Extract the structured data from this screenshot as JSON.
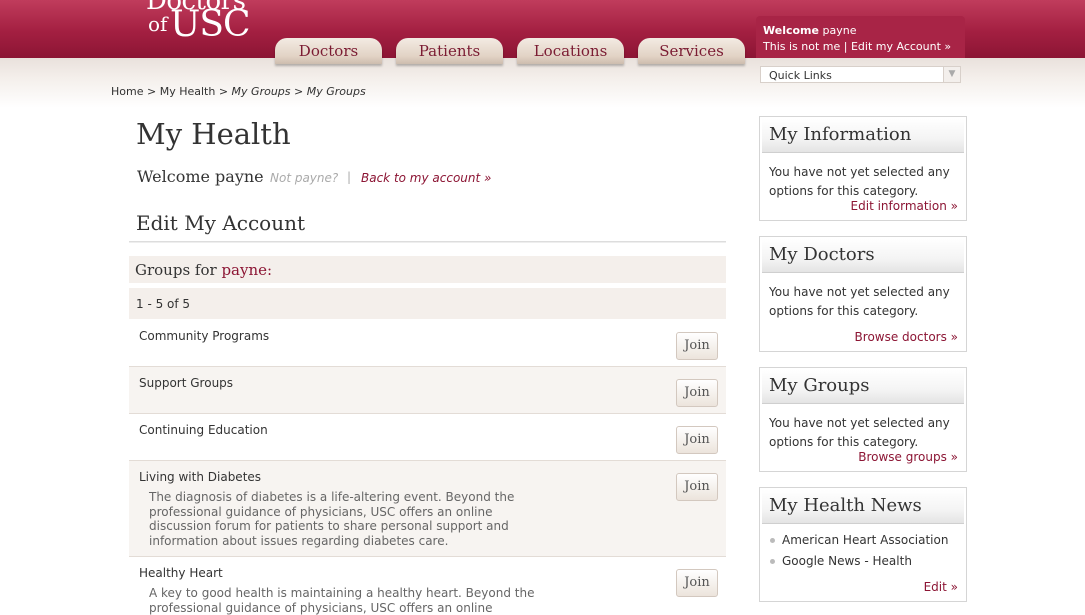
{
  "logo": {
    "line1": "Doctors",
    "line2": "of",
    "line3": "USC"
  },
  "nav": {
    "tabs": [
      "Doctors",
      "Patients",
      "Locations",
      "Services"
    ]
  },
  "user_box": {
    "welcome_label": "Welcome",
    "username": "payne",
    "not_me": "This is not me",
    "separator": "|",
    "edit_account": "Edit my Account »"
  },
  "quick_links": {
    "label": "Quick Links"
  },
  "breadcrumb": {
    "home": "Home",
    "sep": ">",
    "my_health": "My Health",
    "my_groups_1": "My Groups",
    "my_groups_2": "My Groups"
  },
  "main": {
    "title": "My Health",
    "welcome": "Welcome payne",
    "not_user": "Not payne?",
    "separator": "|",
    "back_link": "Back to my account »",
    "section_title": "Edit My Account",
    "groups_prefix": "Groups for",
    "groups_user": "payne:",
    "counter": "1 - 5 of 5",
    "join_label": "Join",
    "groups": [
      {
        "name": "Community Programs",
        "description": ""
      },
      {
        "name": "Support Groups",
        "description": ""
      },
      {
        "name": "Continuing Education",
        "description": ""
      },
      {
        "name": "Living with Diabetes",
        "description": "The diagnosis of diabetes is a life-altering event. Beyond the professional guidance of physicians, USC offers an online discussion forum for patients to share personal support and information about issues regarding diabetes care."
      },
      {
        "name": "Healthy Heart",
        "description": "A key to good health is maintaining a healthy heart. Beyond the professional guidance of physicians, USC offers an online"
      }
    ]
  },
  "sidebar": {
    "my_information": {
      "title": "My Information",
      "text": "You have not yet selected any options for this category.",
      "link": "Edit information »"
    },
    "my_doctors": {
      "title": "My Doctors",
      "text": "You have not yet selected any options for this category.",
      "link": "Browse doctors »"
    },
    "my_groups": {
      "title": "My Groups",
      "text": "You have not yet selected any options for this category.",
      "link": "Browse groups »"
    },
    "my_health_news": {
      "title": "My Health News",
      "items": [
        "American Heart Association",
        "Google News - Health"
      ],
      "link": "Edit »"
    }
  },
  "colors": {
    "brand": "#a31f41",
    "link": "#8c1534",
    "panel_bg": "#f4efeb"
  }
}
